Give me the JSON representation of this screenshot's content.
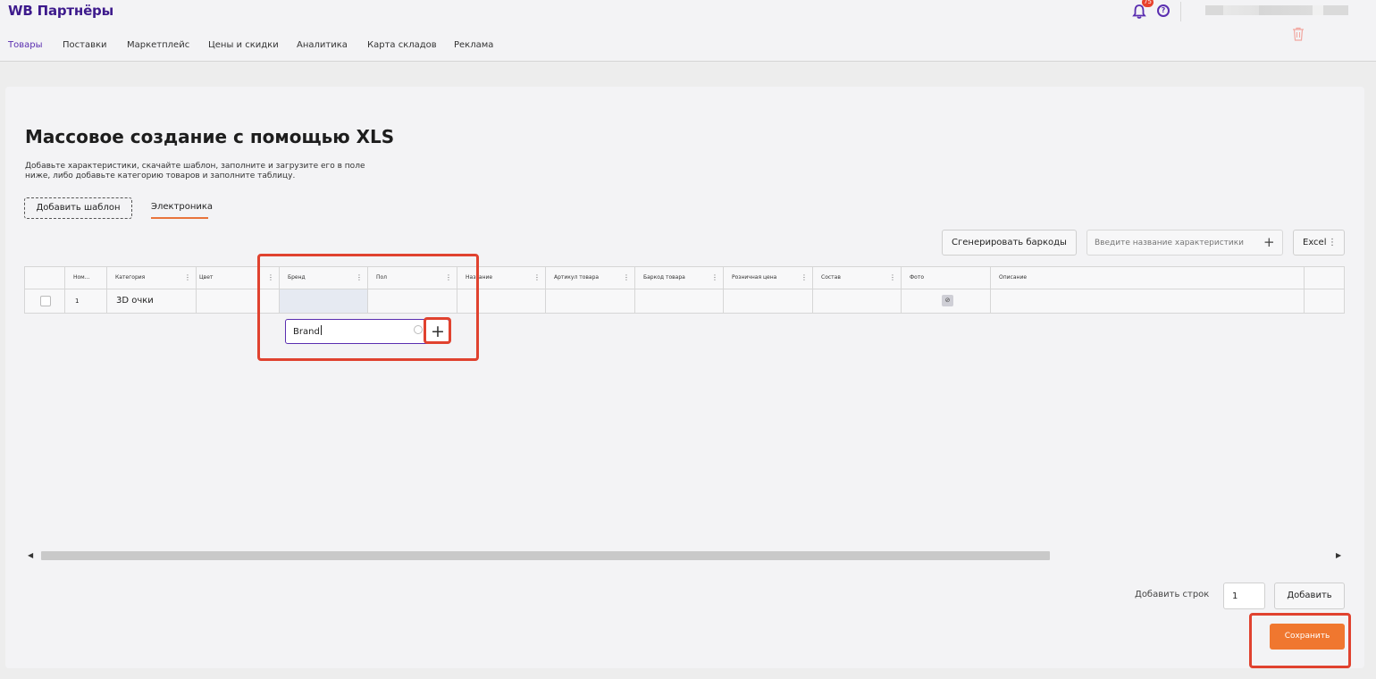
{
  "header": {
    "logo": "WB Партнёры",
    "notifications_count": "75",
    "help_icon": "?"
  },
  "nav": {
    "items": [
      "Товары",
      "Поставки",
      "Маркетплейс",
      "Цены и скидки",
      "Аналитика",
      "Карта складов",
      "Реклама"
    ],
    "active": "Товары"
  },
  "page": {
    "title": "Массовое создание с помощью XLS",
    "description": "Добавьте характеристики, скачайте шаблон, заполните и загрузите его в поле ниже, либо добавьте категорию товаров и заполните таблицу.",
    "add_template_label": "Добавить шаблон",
    "active_tab": "Электроника"
  },
  "toolbar": {
    "generate_barcodes_label": "Сгенерировать баркоды",
    "char_placeholder": "Введите название характеристики",
    "excel_label": "Excel"
  },
  "table": {
    "columns": [
      "Ном...",
      "Категория",
      "Цвет",
      "Бренд",
      "Пол",
      "Название",
      "Артикул товара",
      "Баркод товара",
      "Розничная цена",
      "Состав",
      "Фото",
      "Описание"
    ],
    "rows": [
      {
        "number": "1",
        "category": "3D очки"
      }
    ]
  },
  "brand_popup": {
    "value": "Brand"
  },
  "footer": {
    "add_rows_label": "Добавить строк",
    "rows_value": "1",
    "add_label": "Добавить",
    "save_label": "Сохранить"
  },
  "colors": {
    "brand_purple": "#3d1a8c",
    "accent_orange": "#f0772f",
    "highlight_red": "#e0422f"
  }
}
